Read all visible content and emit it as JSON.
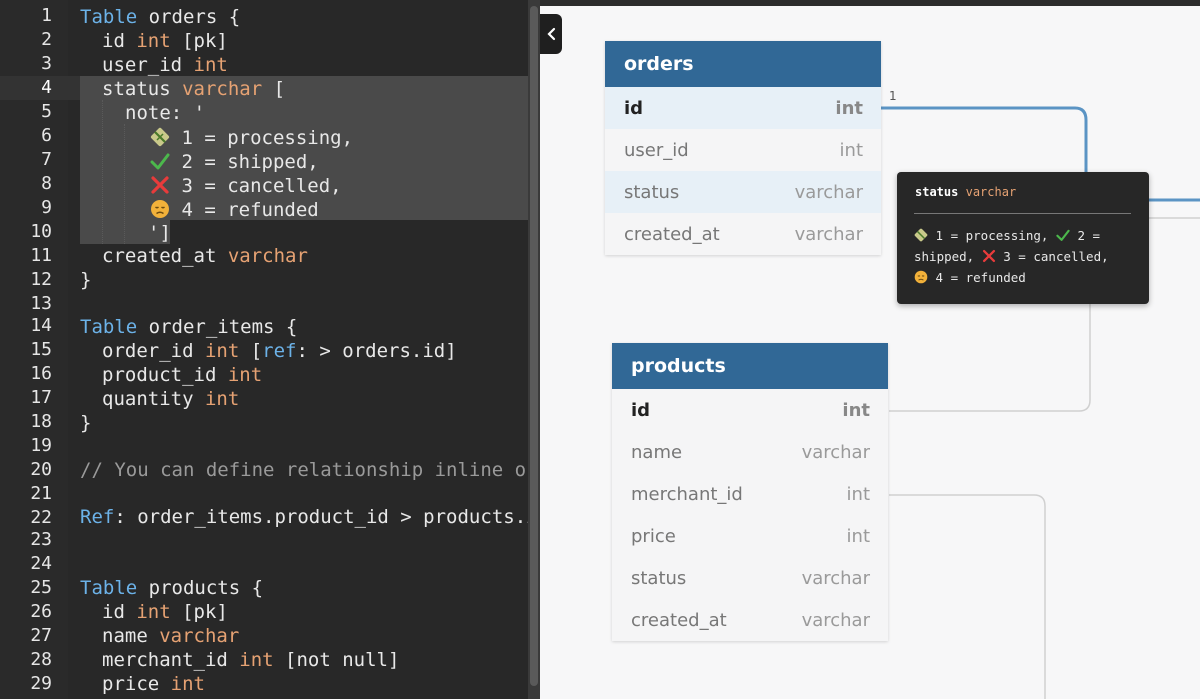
{
  "editor": {
    "line_numbers": [
      "1",
      "2",
      "3",
      "4",
      "5",
      "6",
      "7",
      "8",
      "9",
      "10",
      "11",
      "12",
      "13",
      "14",
      "15",
      "16",
      "17",
      "18",
      "19",
      "20",
      "21",
      "22",
      "23",
      "24",
      "25",
      "26",
      "27",
      "28",
      "29"
    ],
    "kw_table": "Table",
    "kw_ref": "ref",
    "kw_Ref": "Ref",
    "t_int": "int",
    "t_varchar": "varchar",
    "orders_name": " orders {",
    "id_field": "id ",
    "pk": " [pk]",
    "user_id_field": "user_id ",
    "status_field": "status ",
    "bracket_open": " [",
    "note_open": "note: '",
    "note_l1": " 1 = processing,",
    "note_l2": " 2 = shipped,",
    "note_l3": " 3 = cancelled,",
    "note_l4": " 4 = refunded",
    "note_close": "']",
    "created_at_field": "created_at ",
    "close_brace": "}",
    "order_items_name": " order_items {",
    "order_id_field": "order_id ",
    "ref_open": " [",
    "ref_target": ": > orders.id]",
    "product_id_field": "product_id ",
    "quantity_field": "quantity ",
    "comment": "// You can define relationship inline or",
    "ref_line": ": order_items.product_id > products.id",
    "products_name": " products {",
    "name_field": "name ",
    "merchant_id_field": "merchant_id ",
    "not_null": " [not null]",
    "price_field": "price "
  },
  "diagram": {
    "relation_label": "1",
    "orders": {
      "title": "orders",
      "columns": [
        {
          "name": "id",
          "type": "int"
        },
        {
          "name": "user_id",
          "type": "int"
        },
        {
          "name": "status",
          "type": "varchar"
        },
        {
          "name": "created_at",
          "type": "varchar"
        }
      ]
    },
    "products": {
      "title": "products",
      "columns": [
        {
          "name": "id",
          "type": "int"
        },
        {
          "name": "name",
          "type": "varchar"
        },
        {
          "name": "merchant_id",
          "type": "int"
        },
        {
          "name": "price",
          "type": "int"
        },
        {
          "name": "status",
          "type": "varchar"
        },
        {
          "name": "created_at",
          "type": "varchar"
        }
      ]
    },
    "tooltip": {
      "field": "status",
      "type": "varchar",
      "seg1": " 1 = processing, ",
      "seg2": " 2 =",
      "seg3": "shipped, ",
      "seg4": " 3 = cancelled,",
      "seg5": " 4 = refunded"
    }
  },
  "colors": {
    "editor_bg": "#282828",
    "keyword": "#6cb2e8",
    "type": "#e6a273",
    "comment": "#9a9a9a",
    "table_header": "#316896",
    "connector": "#5b94c4",
    "tooltip_bg": "#272727"
  },
  "icons": [
    "package-icon",
    "check-mark-icon",
    "cross-mark-icon",
    "disappointed-face-icon",
    "chevron-left-icon"
  ]
}
